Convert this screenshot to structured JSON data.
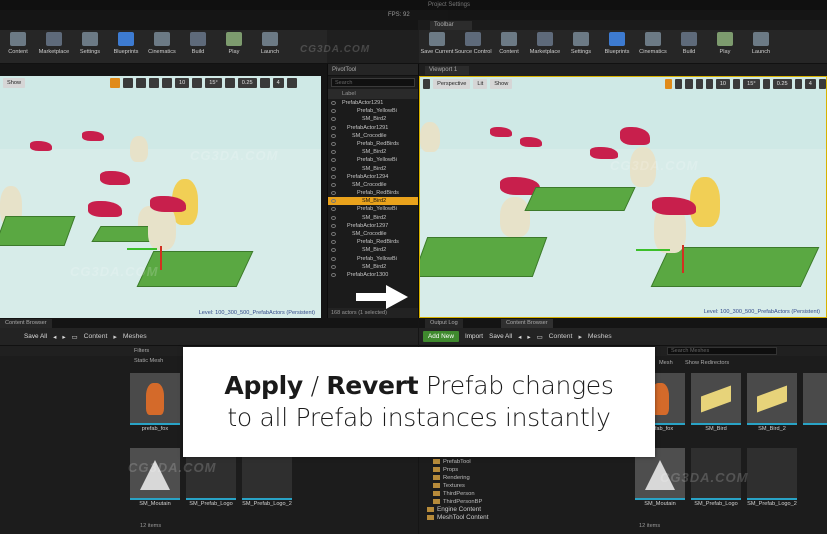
{
  "top": {
    "title": "Project Settings",
    "tab": "Toolbar",
    "fps": "FPS: 92"
  },
  "toolbar_left": [
    {
      "label": "Content",
      "icon": "content-icon"
    },
    {
      "label": "Marketplace",
      "icon": "marketplace-icon"
    },
    {
      "label": "Settings",
      "icon": "settings-icon"
    },
    {
      "label": "Blueprints",
      "icon": "blueprints-icon"
    },
    {
      "label": "Cinematics",
      "icon": "cinematics-icon"
    },
    {
      "label": "Build",
      "icon": "build-icon"
    },
    {
      "label": "Play",
      "icon": "play-icon"
    },
    {
      "label": "Launch",
      "icon": "launch-icon"
    }
  ],
  "toolbar_right": [
    {
      "label": "Save Current",
      "icon": "save-icon"
    },
    {
      "label": "Source Control",
      "icon": "source-control-icon"
    },
    {
      "label": "Content",
      "icon": "content-icon"
    },
    {
      "label": "Marketplace",
      "icon": "marketplace-icon"
    },
    {
      "label": "Settings",
      "icon": "settings-icon"
    },
    {
      "label": "Blueprints",
      "icon": "blueprints-icon"
    },
    {
      "label": "Cinematics",
      "icon": "cinematics-icon"
    },
    {
      "label": "Build",
      "icon": "build-icon"
    },
    {
      "label": "Play",
      "icon": "play-icon"
    },
    {
      "label": "Launch",
      "icon": "launch-icon"
    }
  ],
  "viewport_left": {
    "show": "Show",
    "grid": "10",
    "angle": "15°",
    "scale": "0.25",
    "cam": "4",
    "level": "Level:  100_300_500_PrefabActors (Persistent)"
  },
  "viewport_right": {
    "tab": "Viewport 1",
    "perspective": "Perspective",
    "lit": "Lit",
    "show": "Show",
    "grid": "10",
    "angle": "15°",
    "scale": "0.25",
    "cam": "4",
    "level": "Level:  100_300_500_PrefabActors (Persistent)"
  },
  "pivot": {
    "title": "PivotTool",
    "search": "Search",
    "column": "Label",
    "rows": [
      {
        "label": "PrefabActor1291",
        "indent": 0
      },
      {
        "label": "Prefab_YellowBi",
        "indent": 3
      },
      {
        "label": "SM_Bird2",
        "indent": 4
      },
      {
        "label": "PrefabActor1291",
        "indent": 1
      },
      {
        "label": "SM_Crocodile",
        "indent": 2
      },
      {
        "label": "Prefab_RedBirds",
        "indent": 3
      },
      {
        "label": "SM_Bird2",
        "indent": 4
      },
      {
        "label": "Prefab_YellowBi",
        "indent": 3
      },
      {
        "label": "SM_Bird2",
        "indent": 4
      },
      {
        "label": "PrefabActor1294",
        "indent": 1
      },
      {
        "label": "SM_Crocodile",
        "indent": 2
      },
      {
        "label": "Prefab_RedBirds",
        "indent": 3
      },
      {
        "label": "SM_Bird2",
        "indent": 4,
        "selected": true
      },
      {
        "label": "Prefab_YellowBi",
        "indent": 3
      },
      {
        "label": "SM_Bird2",
        "indent": 4
      },
      {
        "label": "PrefabActor1297",
        "indent": 1
      },
      {
        "label": "SM_Crocodile",
        "indent": 2
      },
      {
        "label": "Prefab_RedBirds",
        "indent": 3
      },
      {
        "label": "SM_Bird2",
        "indent": 4
      },
      {
        "label": "Prefab_YellowBi",
        "indent": 3
      },
      {
        "label": "SM_Bird2",
        "indent": 4
      },
      {
        "label": "PrefabActor1300",
        "indent": 1
      }
    ],
    "footer": "168 actors (1 selected)"
  },
  "content_left": {
    "tab": "Content Browser",
    "save_all": "Save All",
    "crumbs": [
      "Content",
      "Meshes"
    ],
    "filters": "Filters",
    "static_mesh": "Static Mesh",
    "assets": [
      {
        "label": "prefab_fox"
      },
      {
        "label": "SM_Moutain"
      },
      {
        "label": "SM_Prefab_Logo"
      },
      {
        "label": "SM_Prefab_Logo_2"
      }
    ],
    "items": "12 items"
  },
  "content_right": {
    "tab_output": "Output Log",
    "tab_cb": "Content Browser",
    "add_new": "Add New",
    "import": "Import",
    "save_all": "Save All",
    "crumbs": [
      "Content",
      "Meshes"
    ],
    "search": "Search Meshes",
    "show_redirectors": "Show Redirectors",
    "static_mesh": "Mesh",
    "assets": [
      {
        "label": "prefab_fox"
      },
      {
        "label": "SM_Bird"
      },
      {
        "label": "SM_Bird_2"
      },
      {
        "label": "SM_Moutain"
      },
      {
        "label": "SM_Prefab_Logo"
      },
      {
        "label": "SM_Prefab_Logo_2"
      }
    ],
    "folders": [
      "PrefabTool",
      "Props",
      "Rendering",
      "Textures",
      "ThirdPerson",
      "ThirdPersonBP",
      "Engine Content",
      "MeshTool Content"
    ],
    "items": "12 items"
  },
  "overlay": {
    "line1_bold1": "Apply",
    "line1_sep": " / ",
    "line1_bold2": "Revert",
    "line1_rest": " Prefab changes",
    "line2": "to all Prefab instances instantly"
  },
  "watermark": "CG3DA.COM",
  "colors": {
    "accent_orange": "#e9a21c",
    "add_new_green": "#3f8a2e",
    "asset_bar": "#29a3c6",
    "viewport_bg": "#cfe9e6"
  }
}
